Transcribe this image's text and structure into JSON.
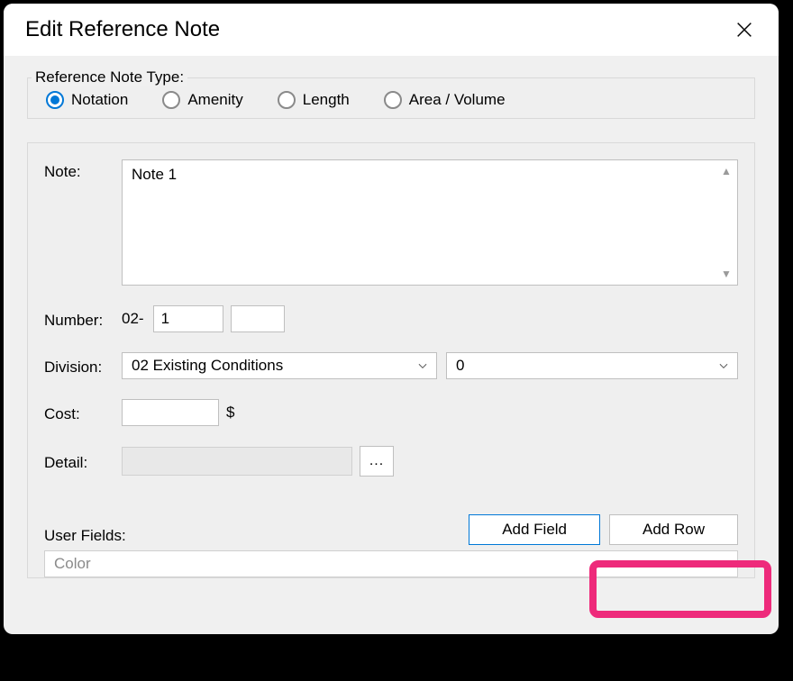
{
  "window": {
    "title": "Edit Reference Note"
  },
  "typeGroup": {
    "label": "Reference Note Type:",
    "options": {
      "notation": "Notation",
      "amenity": "Amenity",
      "length": "Length",
      "areaVolume": "Area / Volume"
    },
    "selected": "notation"
  },
  "form": {
    "noteLabel": "Note:",
    "noteValue": "Note 1",
    "numberLabel": "Number:",
    "numberPrefix": "02-",
    "numberValue": "1",
    "numberSuffixValue": "",
    "divisionLabel": "Division:",
    "divisionValue": "02  Existing Conditions",
    "divisionSubValue": "0",
    "costLabel": "Cost:",
    "costValue": "",
    "costSuffix": "$",
    "detailLabel": "Detail:",
    "detailValue": "",
    "browseLabel": "..."
  },
  "userFields": {
    "label": "User Fields:",
    "addFieldLabel": "Add Field",
    "addRowLabel": "Add Row",
    "column0": "Color"
  }
}
